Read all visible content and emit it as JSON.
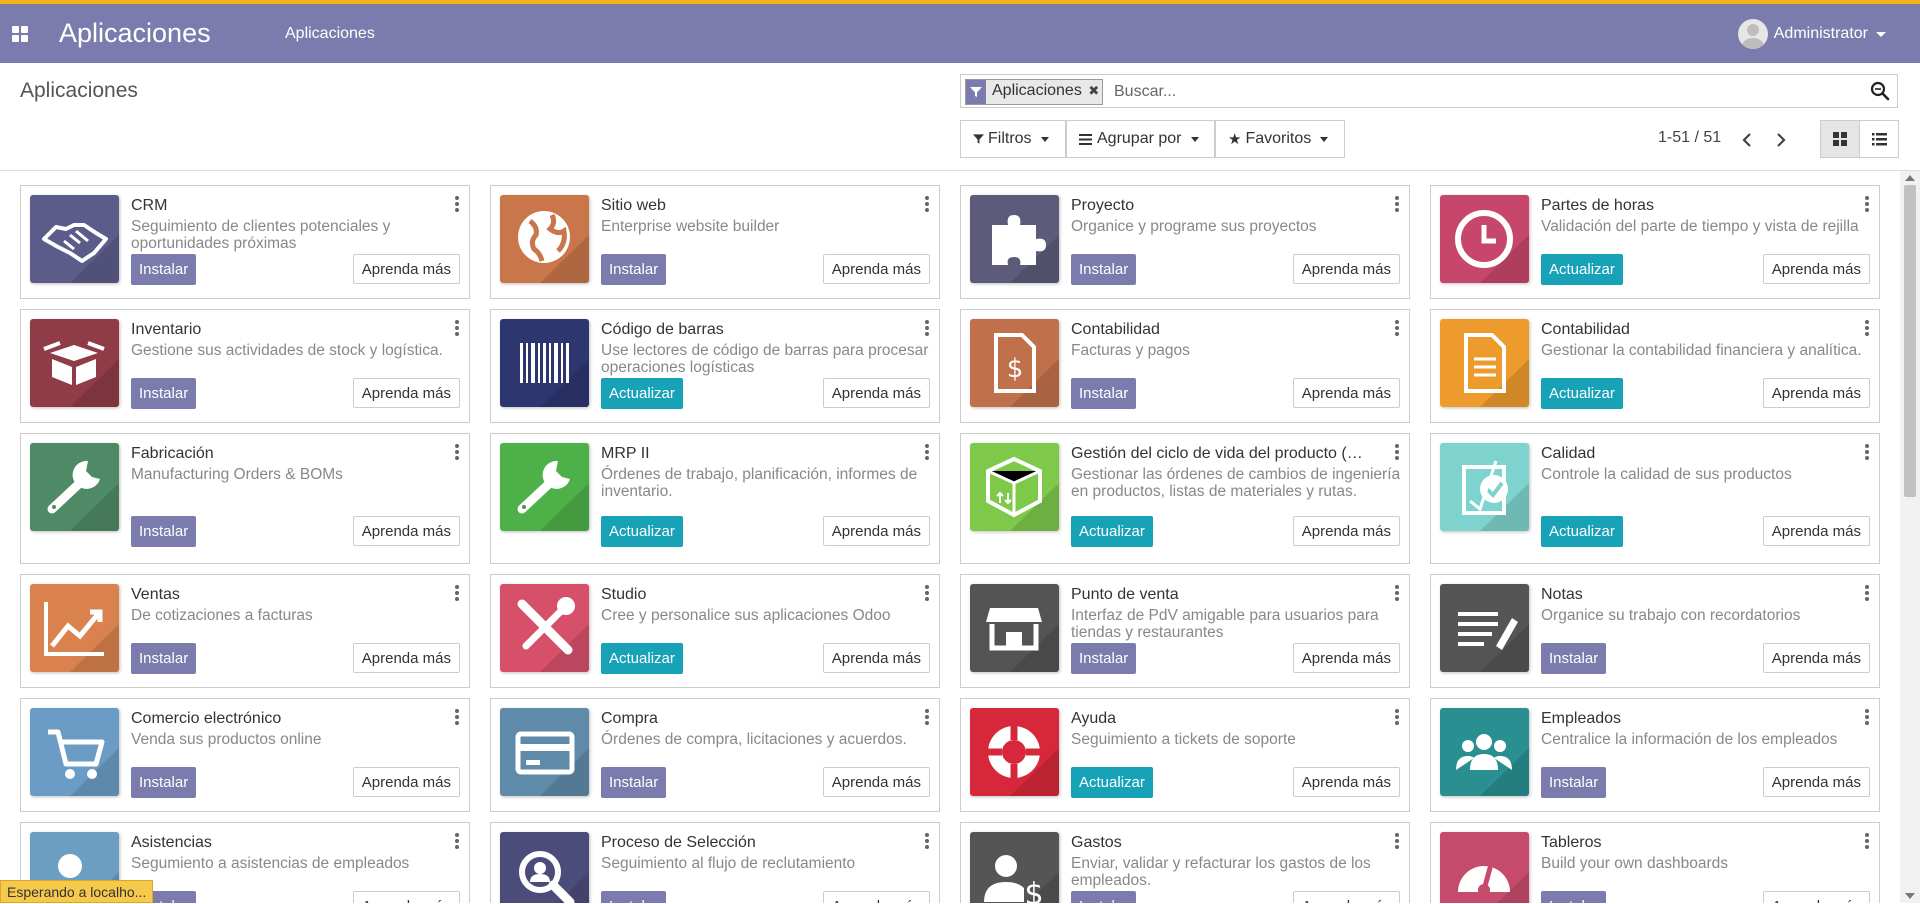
{
  "navbar": {
    "brand": "Aplicaciones",
    "menu_item": "Aplicaciones",
    "user_name": "Administrator",
    "bg_color": "#7c7bad",
    "accent_line_color": "#f3b31a"
  },
  "control_panel": {
    "title": "Aplicaciones",
    "search": {
      "facet_label": "Aplicaciones",
      "facet_icon": "filter-icon",
      "placeholder": "Buscar..."
    },
    "filters_label": "Filtros",
    "group_by_label": "Agrupar por",
    "favorites_label": "Favoritos",
    "pager": "1-51 / 51"
  },
  "buttons": {
    "install": "Instalar",
    "update": "Actualizar",
    "learn_more": "Aprenda más"
  },
  "apps": [
    {
      "name": "CRM",
      "desc": "Seguimiento de clientes potenciales y oportunidades próximas",
      "action": "Instalar",
      "icon": "handshake-icon",
      "color": "#5c5c8a"
    },
    {
      "name": "Sitio web",
      "desc": "Enterprise website builder",
      "action": "Instalar",
      "icon": "globe-icon",
      "color": "#c8764a"
    },
    {
      "name": "Proyecto",
      "desc": "Organice y programe sus proyectos",
      "action": "Instalar",
      "icon": "puzzle-icon",
      "color": "#5c5c7a"
    },
    {
      "name": "Partes de horas",
      "desc": "Validación del parte de tiempo y vista de rejilla",
      "action": "Actualizar",
      "icon": "clock-icon",
      "color": "#c7466b"
    },
    {
      "name": "Inventario",
      "desc": "Gestione sus actividades de stock y logística.",
      "action": "Instalar",
      "icon": "box-icon",
      "color": "#8f3c46"
    },
    {
      "name": "Código de barras",
      "desc": "Use lectores de código de barras para procesar operaciones logísticas",
      "action": "Actualizar",
      "icon": "barcode-icon",
      "color": "#2e3670"
    },
    {
      "name": "Contabilidad",
      "desc": "Facturas y pagos",
      "action": "Instalar",
      "icon": "invoice-dollar-icon",
      "color": "#c0704a"
    },
    {
      "name": "Contabilidad",
      "desc": "Gestionar la contabilidad financiera y analítica.",
      "action": "Actualizar",
      "icon": "document-icon",
      "color": "#ed9b2d"
    },
    {
      "name": "Fabricación",
      "desc": "Manufacturing Orders & BOMs",
      "action": "Instalar",
      "icon": "wrench-icon",
      "color": "#4f8a67"
    },
    {
      "name": "MRP II",
      "desc": "Órdenes de trabajo, planificación, informes de inventario.",
      "action": "Actualizar",
      "icon": "wrench-icon",
      "color": "#4eb048"
    },
    {
      "name": "Gestión del ciclo de vida del producto (…",
      "desc": "Gestionar las órdenes de cambios de ingeniería en productos, listas de materiales y rutas.",
      "action": "Actualizar",
      "icon": "cube-icon",
      "color": "#7ec84a"
    },
    {
      "name": "Calidad",
      "desc": "Controle la calidad de sus productos",
      "action": "Actualizar",
      "icon": "quality-check-icon",
      "color": "#7fd3ce"
    },
    {
      "name": "Ventas",
      "desc": "De cotizaciones a facturas",
      "action": "Instalar",
      "icon": "trend-chart-icon",
      "color": "#d9824e"
    },
    {
      "name": "Studio",
      "desc": "Cree y personalice sus aplicaciones Odoo",
      "action": "Actualizar",
      "icon": "tools-icon",
      "color": "#d6506a"
    },
    {
      "name": "Punto de venta",
      "desc": "Interfaz de PdV amigable para usuarios para tiendas y restaurantes",
      "action": "Instalar",
      "icon": "store-icon",
      "color": "#545454"
    },
    {
      "name": "Notas",
      "desc": "Organice su trabajo con recordatorios",
      "action": "Instalar",
      "icon": "notes-icon",
      "color": "#555555"
    },
    {
      "name": "Comercio electrónico",
      "desc": "Venda sus productos online",
      "action": "Instalar",
      "icon": "cart-icon",
      "color": "#6a9cc5"
    },
    {
      "name": "Compra",
      "desc": "Órdenes de compra, licitaciones y acuerdos.",
      "action": "Instalar",
      "icon": "credit-card-icon",
      "color": "#5f8aaa"
    },
    {
      "name": "Ayuda",
      "desc": "Seguimiento a tickets de soporte",
      "action": "Actualizar",
      "icon": "lifebuoy-icon",
      "color": "#d6283a"
    },
    {
      "name": "Empleados",
      "desc": "Centralice la información de los empleados",
      "action": "Instalar",
      "icon": "people-icon",
      "color": "#2a8f91"
    },
    {
      "name": "Asistencias",
      "desc": "Segumiento a asistencias de empleados",
      "action": "Instalar",
      "icon": "user-clock-icon",
      "color": "#6c9ec2"
    },
    {
      "name": "Proceso de Selección",
      "desc": "Seguimiento al flujo de reclutamiento",
      "action": "Instalar",
      "icon": "magnifier-icon",
      "color": "#4c4c7a"
    },
    {
      "name": "Gastos",
      "desc": "Enviar, validar y refacturar los gastos de los empleados.",
      "action": "Instalar",
      "icon": "user-dollar-icon",
      "color": "#555555"
    },
    {
      "name": "Tableros",
      "desc": "Build your own dashboards",
      "action": "Instalar",
      "icon": "gauge-icon",
      "color": "#c64a6b"
    }
  ],
  "status_bar": "Esperando a localho..."
}
